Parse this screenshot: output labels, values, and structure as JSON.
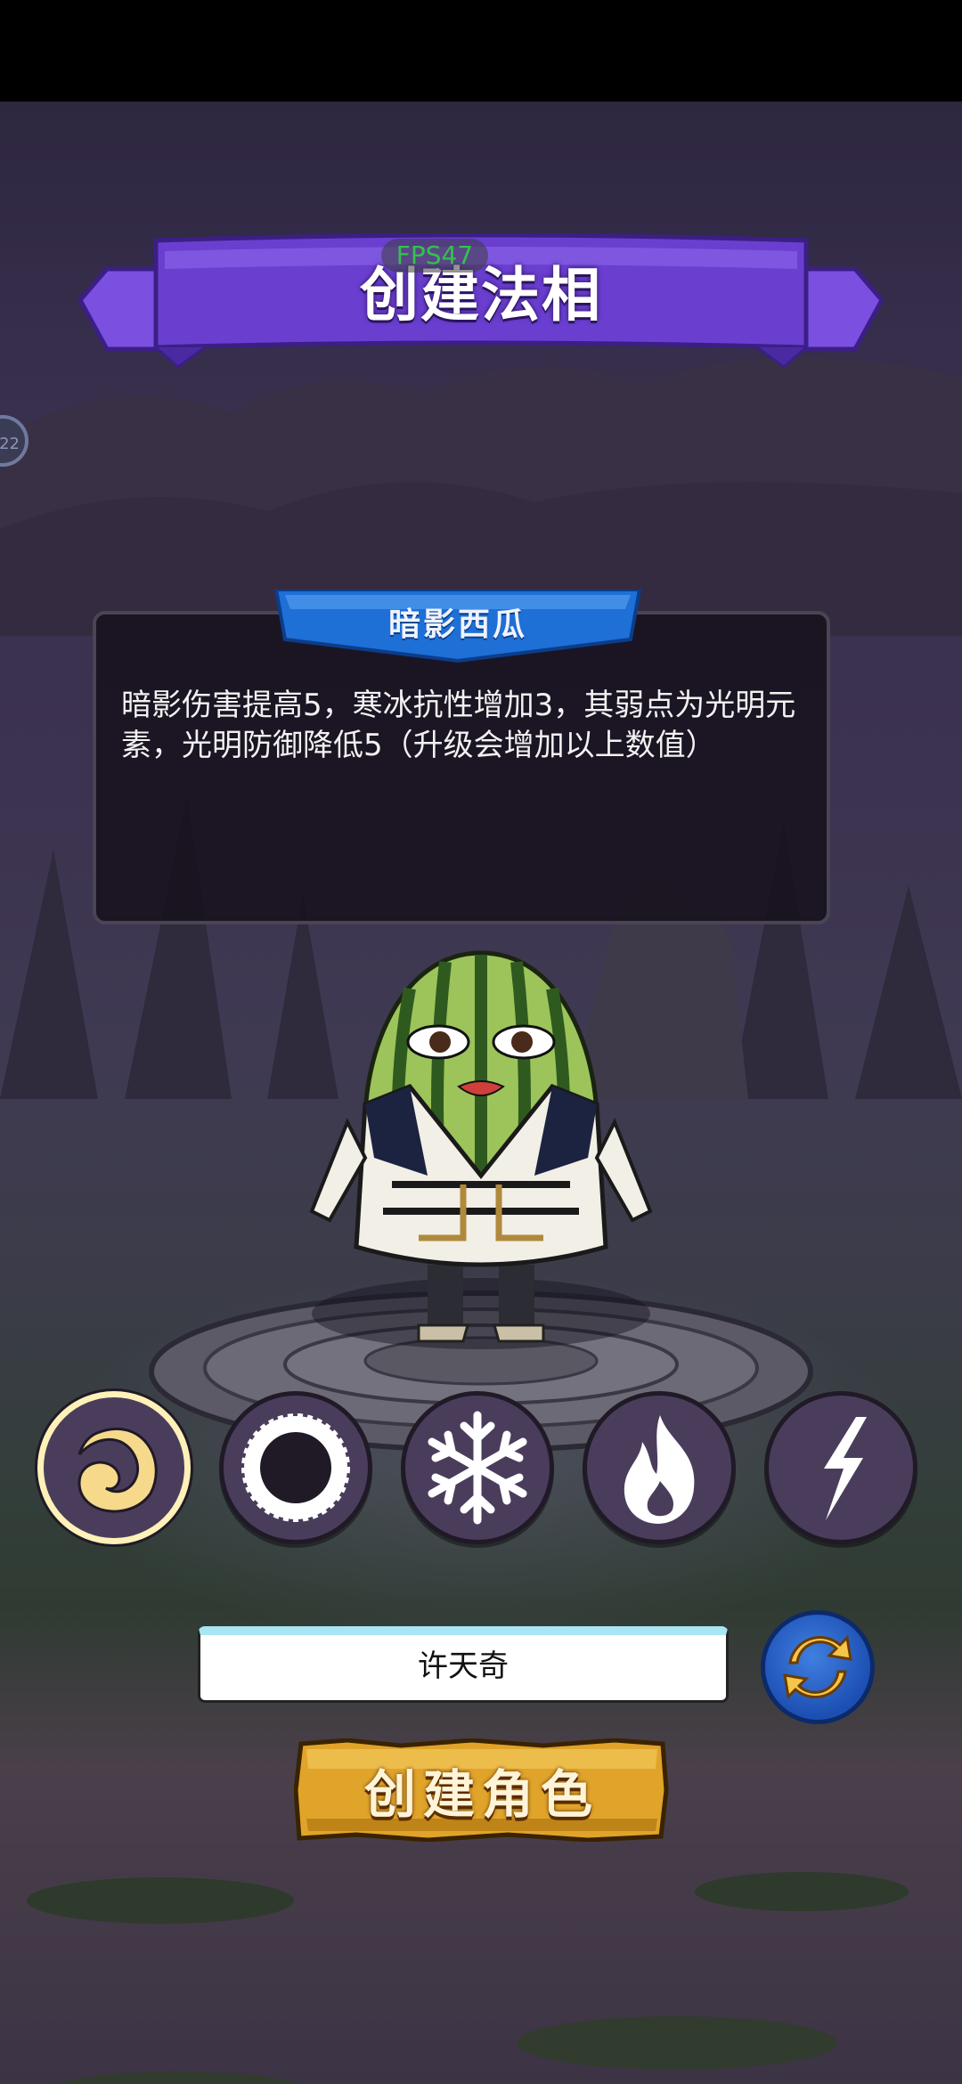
{
  "header": {
    "title": "创建法相",
    "fps": "FPS47",
    "side_handle": "22"
  },
  "description": {
    "title": "暗影西瓜",
    "text": "暗影伤害提高5，寒冰抗性增加3，其弱点为光明元素，光明防御降低5（升级会增加以上数值）"
  },
  "elements": [
    {
      "name": "shadow",
      "icon": "crescent-moon-icon",
      "selected": true
    },
    {
      "name": "light",
      "icon": "sun-icon",
      "selected": false
    },
    {
      "name": "ice",
      "icon": "snowflake-icon",
      "selected": false
    },
    {
      "name": "fire",
      "icon": "flame-icon",
      "selected": false
    },
    {
      "name": "thunder",
      "icon": "lightning-icon",
      "selected": false
    }
  ],
  "name_input": {
    "value": "许天奇"
  },
  "refresh_button": {
    "icon": "refresh-icon"
  },
  "create_button": {
    "label": "创建角色"
  },
  "colors": {
    "banner": "#6a3fd0",
    "ribbon": "#1e6fd6",
    "create_button": "#e0a42a",
    "selected_ring": "#fff1b8"
  }
}
